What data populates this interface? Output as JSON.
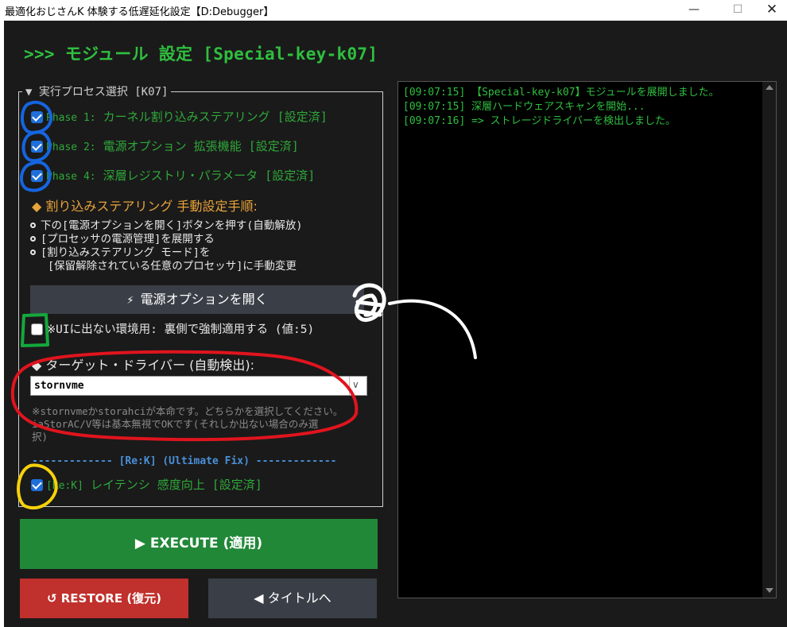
{
  "window": {
    "title": "最適化おじさんK 体験する低遅延化設定【D:Debugger】",
    "minimize": "—",
    "maximize": "☐",
    "close": "✕"
  },
  "heading": ">>> モジュール 設定 [Special-key-k07]",
  "panel": {
    "legend": "▼ 実行プロセス選択 [K07]",
    "phases": [
      {
        "prefix": "Phase 1:",
        "label": " カーネル割り込みステアリング [設定済]",
        "checked": true
      },
      {
        "prefix": "Phase 2:",
        "label": " 電源オプション 拡張機能 [設定済]",
        "checked": true
      },
      {
        "prefix": "Phase 4:",
        "label": " 深層レジストリ・パラメータ [設定済]",
        "checked": true
      }
    ],
    "manual_heading": "◆ 割り込みステアリング 手動設定手順:",
    "steps": [
      "下の[電源オプションを開く]ボタンを押す(自動解放)",
      "[プロセッサの電源管理]を展開する",
      "[割り込みステアリング モード]を"
    ],
    "step_cont": "[保留解除されている任意のプロセッサ]に手動変更",
    "open_power_button": "電源オプションを開く",
    "hidden_env_label": "※UIに出ない環境用: 裏側で強制適用する (値:5)",
    "target_heading": "◆ ターゲット・ドライバー (自動検出):",
    "driver_select": {
      "value": "stornvme",
      "arrow": "∨"
    },
    "note_lines": [
      "※stornvmeかstorahciが本命です。どちらかを選択してください。",
      " iaStorAC/V等は基本無視でOKです(それしか出ない場合のみ選",
      "択)"
    ],
    "divider": "------------- [Re:K] (Ultimate Fix) -------------",
    "rek": {
      "prefix": "[Re:K]",
      "label": " レイテンシ 感度向上 [設定済]",
      "checked": true
    }
  },
  "buttons": {
    "execute": "▶ EXECUTE (適用)",
    "restore": "↺ RESTORE (復元)",
    "title": "◀ タイトルへ"
  },
  "log": {
    "lines": [
      "[09:07:15] 【Special-key-k07】モジュールを展開しました。",
      "[09:07:15] 深層ハードウェアスキャンを開始...",
      "[09:07:16] => ストレージドライバーを検出しました。"
    ]
  },
  "colors": {
    "accent_green": "#2fbf3f",
    "checkbox_blue": "#1e6fd9",
    "execute_green": "#218838",
    "restore_red": "#c0302c",
    "section_orange": "#e8a33a",
    "annotation_blue": "#1565e0",
    "annotation_red": "#e0141e",
    "annotation_yellow": "#f5d10a",
    "annotation_green": "#14a83c"
  }
}
